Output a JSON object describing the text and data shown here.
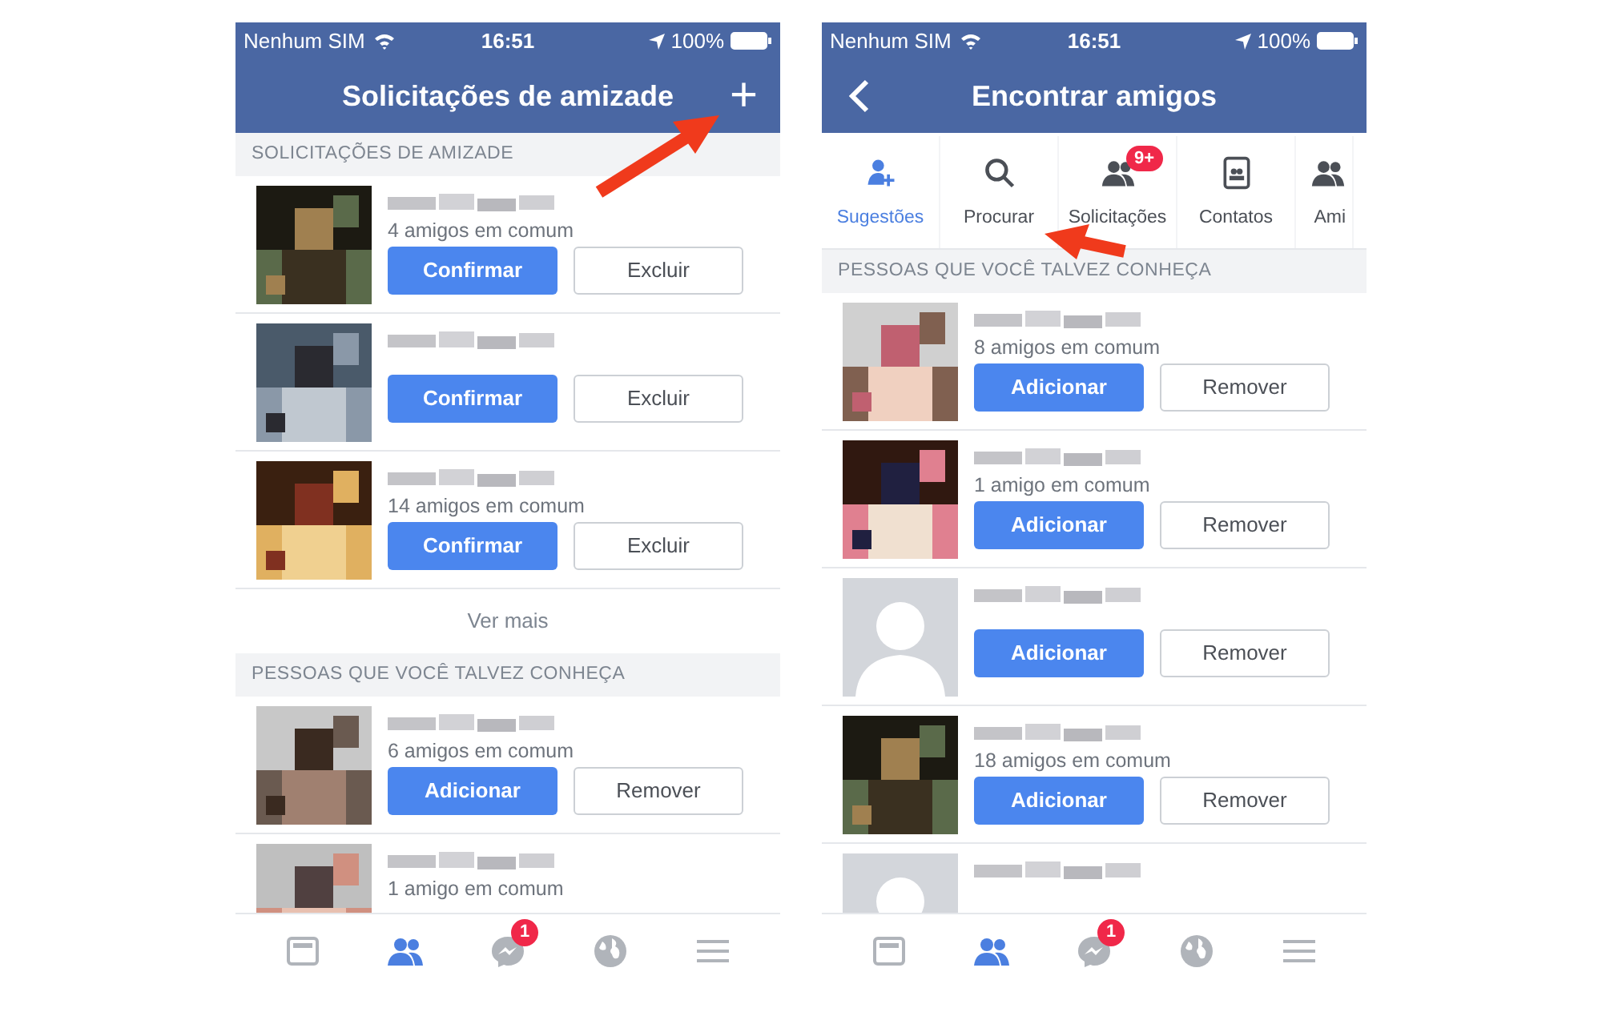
{
  "screens": [
    {
      "status_bar": {
        "carrier": "Nenhum SIM",
        "time": "16:51",
        "battery": "100%"
      },
      "nav": {
        "back": false,
        "title": "Solicitações de amizade",
        "action": "+"
      },
      "sections": [
        {
          "header": "SOLICITAÇÕES DE AMIZADE",
          "rows": [
            {
              "kind": "picture",
              "mutual": "4 amigos em comum",
              "primary": "Confirmar",
              "secondary": "Excluir"
            },
            {
              "kind": "picture",
              "primary": "Confirmar",
              "secondary": "Excluir"
            },
            {
              "kind": "picture",
              "mutual": "14 amigos em comum",
              "primary": "Confirmar",
              "secondary": "Excluir"
            }
          ],
          "more": "Ver mais"
        },
        {
          "header": "PESSOAS QUE VOCÊ TALVEZ CONHEÇA",
          "rows": [
            {
              "kind": "picture",
              "mutual": "6 amigos em comum",
              "primary": "Adicionar",
              "secondary": "Remover"
            },
            {
              "kind": "picture",
              "mutual": "1 amigo em comum"
            }
          ]
        }
      ],
      "tab_bar": [
        {
          "selected": false
        },
        {
          "selected": true
        },
        {
          "selected": false,
          "badge": "1"
        },
        {
          "selected": false
        },
        {
          "selected": false
        }
      ]
    },
    {
      "status_bar": {
        "carrier": "Nenhum SIM",
        "time": "16:51",
        "battery": "100%"
      },
      "nav": {
        "back": true,
        "title": "Encontrar amigos"
      },
      "tabs": [
        {
          "label": "Sugestões",
          "selected": true
        },
        {
          "label": "Procurar",
          "selected": false
        },
        {
          "label": "Solicitações",
          "selected": false,
          "badge": "9+"
        },
        {
          "label": "Contatos",
          "selected": false
        },
        {
          "label": "Ami",
          "selected": false
        }
      ],
      "sections": [
        {
          "header": "PESSOAS QUE VOCÊ TALVEZ CONHEÇA",
          "rows": [
            {
              "kind": "picture",
              "mutual": "8 amigos em comum",
              "primary": "Adicionar",
              "secondary": "Remover"
            },
            {
              "kind": "picture",
              "mutual": "1 amigo em comum",
              "primary": "Adicionar",
              "secondary": "Remover"
            },
            {
              "kind": "blank",
              "primary": "Adicionar",
              "secondary": "Remover"
            },
            {
              "kind": "picture",
              "mutual": "18 amigos em comum",
              "primary": "Adicionar",
              "secondary": "Remover"
            },
            {
              "kind": "blank"
            }
          ]
        }
      ],
      "tab_bar": [
        {
          "selected": false
        },
        {
          "selected": true
        },
        {
          "selected": false,
          "badge": "1"
        },
        {
          "selected": false
        },
        {
          "selected": false
        }
      ]
    }
  ]
}
